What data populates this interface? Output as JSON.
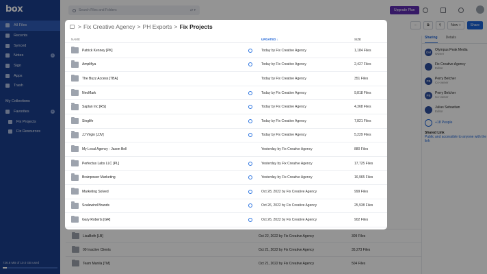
{
  "app": {
    "logo": "box"
  },
  "sidebar": {
    "items": [
      {
        "label": "All Files",
        "icon": "folder-icon",
        "active": true
      },
      {
        "label": "Recents",
        "icon": "clock-icon"
      },
      {
        "label": "Synced",
        "icon": "sync-icon"
      },
      {
        "label": "Notes",
        "icon": "notes-icon",
        "add": true
      },
      {
        "label": "Sign",
        "icon": "sign-icon"
      },
      {
        "label": "Apps",
        "icon": "apps-icon"
      },
      {
        "label": "Trash",
        "icon": "trash-icon"
      }
    ],
    "collections_label": "My Collections",
    "favorites_label": "Favorites",
    "favorites": [
      {
        "label": "Fix Projects",
        "icon": "folder-icon"
      },
      {
        "label": "Fix Resources",
        "icon": "folder-icon"
      }
    ],
    "storage_text": "726.8 MB of 10.0 GB used",
    "storage_fraction": 0.07
  },
  "header": {
    "search_placeholder": "Search Files and Folders",
    "upgrade_label": "Upgrade Plan"
  },
  "toolbar": {
    "new_label": "New +",
    "share_label": "Share"
  },
  "side_panel": {
    "tabs": [
      "Sharing",
      "Details"
    ],
    "collaborators": [
      {
        "initials": "OM",
        "name": "Olympus Peak Media",
        "role": "Owner"
      },
      {
        "initials": "",
        "name": "Fix Creative Agency",
        "role": "Editor"
      },
      {
        "initials": "PB",
        "name": "Perry Belcher",
        "role": "Co-owner"
      },
      {
        "initials": "PB",
        "name": "Perry Belcher",
        "role": "Co-owner"
      },
      {
        "initials": "",
        "name": "Julius Sebastian",
        "role": "Editor"
      }
    ],
    "people_label": "+18 People",
    "shared_link_title": "Shared Link",
    "shared_link_desc": "Public and accessible to anyone with the link"
  },
  "modal": {
    "breadcrumb": [
      "Fix Creative Agency",
      "PH Exports",
      "Fix Projects"
    ],
    "columns": {
      "name": "NAME",
      "updated": "UPDATED ↓",
      "size": "SIZE"
    },
    "rows": [
      {
        "name": "Patrick Kenney [PK]",
        "synced": true,
        "updated": "Today by Fix Creative Agency",
        "size": "1,184 Files"
      },
      {
        "name": "Amplifiya",
        "synced": true,
        "updated": "Today by Fix Creative Agency",
        "size": "2,427 Files"
      },
      {
        "name": "The Buzz Access [TBA]",
        "synced": false,
        "updated": "Today by Fix Creative Agency",
        "size": "351 Files"
      },
      {
        "name": "NeoMark",
        "synced": true,
        "updated": "Today by Fix Creative Agency",
        "size": "9,818 Files"
      },
      {
        "name": "Saplan Inc [RS]",
        "synced": true,
        "updated": "Today by Fix Creative Agency",
        "size": "4,368 Files"
      },
      {
        "name": "Singlife",
        "synced": true,
        "updated": "Today by Fix Creative Agency",
        "size": "7,821 Files"
      },
      {
        "name": "JJ Virgin [JJV]",
        "synced": true,
        "updated": "Today by Fix Creative Agency",
        "size": "5,229 Files"
      },
      {
        "name": "My Local Agency - Jason Bell",
        "synced": false,
        "updated": "Yesterday by Fix Creative Agency",
        "size": "880 Files"
      },
      {
        "name": "Perfectus Labs LLC [PL]",
        "synced": true,
        "updated": "Yesterday by Fix Creative Agency",
        "size": "17,725 Files"
      },
      {
        "name": "Brainpower Marketing",
        "synced": true,
        "updated": "Yesterday by Fix Creative Agency",
        "size": "16,965 Files"
      },
      {
        "name": "Marketing Solved",
        "synced": true,
        "updated": "Oct 28, 2022 by Fix Creative Agency",
        "size": "999 Files"
      },
      {
        "name": "Scalewind Brands",
        "synced": true,
        "updated": "Oct 26, 2022 by Fix Creative Agency",
        "size": "25,938 Files"
      },
      {
        "name": "Gary Roberts [GR]",
        "synced": true,
        "updated": "Oct 26, 2022 by Fix Creative Agency",
        "size": "902 Files"
      }
    ]
  },
  "background_rows": [
    {
      "name": "LisaBeth [LB]",
      "updated": "Oct 22, 2022 by Fix Creative Agency",
      "size": "309 Files"
    },
    {
      "name": "00 Inactive Clients",
      "updated": "Oct 21, 2022 by Fix Creative Agency",
      "size": "35,273 Files"
    },
    {
      "name": "Team Manila [TM]",
      "updated": "Oct 21, 2022 by Fix Creative Agency",
      "size": "504 Files"
    }
  ]
}
